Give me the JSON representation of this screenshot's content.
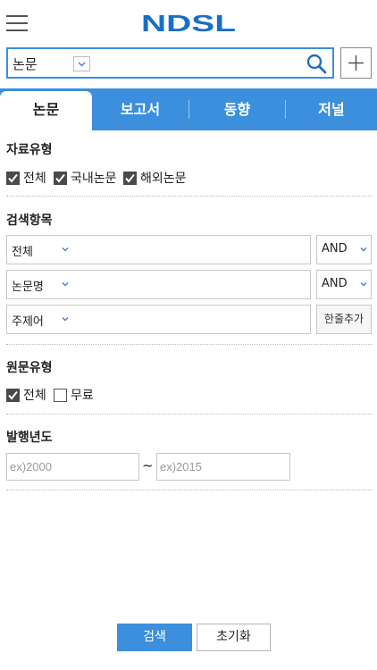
{
  "header": {
    "logo_text": "NDSL",
    "menu_icon": "hamburger-icon",
    "logo_color": "#1a6fc4"
  },
  "search": {
    "type_value": "논문",
    "query_value": "",
    "search_icon": "search-icon",
    "add_icon": "plus-icon",
    "border_color": "#3a8fdc"
  },
  "tabs": [
    {
      "label": "논문",
      "active": true
    },
    {
      "label": "보고서",
      "active": false
    },
    {
      "label": "동향",
      "active": false
    },
    {
      "label": "저널",
      "active": false
    }
  ],
  "tab_color": "#3b8fdd",
  "material_type": {
    "title": "자료유형",
    "options": [
      {
        "label": "전체",
        "checked": true
      },
      {
        "label": "국내논문",
        "checked": true
      },
      {
        "label": "해외논문",
        "checked": true
      }
    ]
  },
  "search_fields": {
    "title": "검색항목",
    "rows": [
      {
        "field": "전체",
        "operator": "AND"
      },
      {
        "field": "논문명",
        "operator": "AND"
      },
      {
        "field": "주제어"
      }
    ],
    "add_line_label": "한줄추가"
  },
  "source_type": {
    "title": "원문유형",
    "options": [
      {
        "label": "전체",
        "checked": true
      },
      {
        "label": "무료",
        "checked": false
      }
    ]
  },
  "pub_year": {
    "title": "발행년도",
    "from_placeholder": "ex)2000",
    "separator": "~",
    "to_placeholder": "ex)2015"
  },
  "actions": {
    "search_label": "검색",
    "reset_label": "초기화"
  }
}
